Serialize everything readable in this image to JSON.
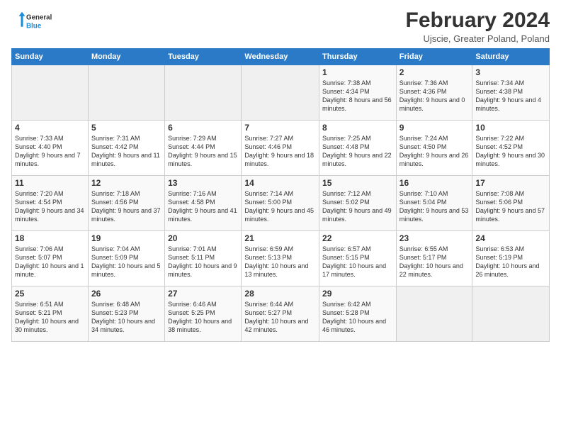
{
  "logo": {
    "general": "General",
    "blue": "Blue"
  },
  "header": {
    "title": "February 2024",
    "location": "Ujscie, Greater Poland, Poland"
  },
  "days": [
    "Sunday",
    "Monday",
    "Tuesday",
    "Wednesday",
    "Thursday",
    "Friday",
    "Saturday"
  ],
  "weeks": [
    [
      {
        "day": "",
        "detail": ""
      },
      {
        "day": "",
        "detail": ""
      },
      {
        "day": "",
        "detail": ""
      },
      {
        "day": "",
        "detail": ""
      },
      {
        "day": "1",
        "detail": "Sunrise: 7:38 AM\nSunset: 4:34 PM\nDaylight: 8 hours\nand 56 minutes."
      },
      {
        "day": "2",
        "detail": "Sunrise: 7:36 AM\nSunset: 4:36 PM\nDaylight: 9 hours\nand 0 minutes."
      },
      {
        "day": "3",
        "detail": "Sunrise: 7:34 AM\nSunset: 4:38 PM\nDaylight: 9 hours\nand 4 minutes."
      }
    ],
    [
      {
        "day": "4",
        "detail": "Sunrise: 7:33 AM\nSunset: 4:40 PM\nDaylight: 9 hours\nand 7 minutes."
      },
      {
        "day": "5",
        "detail": "Sunrise: 7:31 AM\nSunset: 4:42 PM\nDaylight: 9 hours\nand 11 minutes."
      },
      {
        "day": "6",
        "detail": "Sunrise: 7:29 AM\nSunset: 4:44 PM\nDaylight: 9 hours\nand 15 minutes."
      },
      {
        "day": "7",
        "detail": "Sunrise: 7:27 AM\nSunset: 4:46 PM\nDaylight: 9 hours\nand 18 minutes."
      },
      {
        "day": "8",
        "detail": "Sunrise: 7:25 AM\nSunset: 4:48 PM\nDaylight: 9 hours\nand 22 minutes."
      },
      {
        "day": "9",
        "detail": "Sunrise: 7:24 AM\nSunset: 4:50 PM\nDaylight: 9 hours\nand 26 minutes."
      },
      {
        "day": "10",
        "detail": "Sunrise: 7:22 AM\nSunset: 4:52 PM\nDaylight: 9 hours\nand 30 minutes."
      }
    ],
    [
      {
        "day": "11",
        "detail": "Sunrise: 7:20 AM\nSunset: 4:54 PM\nDaylight: 9 hours\nand 34 minutes."
      },
      {
        "day": "12",
        "detail": "Sunrise: 7:18 AM\nSunset: 4:56 PM\nDaylight: 9 hours\nand 37 minutes."
      },
      {
        "day": "13",
        "detail": "Sunrise: 7:16 AM\nSunset: 4:58 PM\nDaylight: 9 hours\nand 41 minutes."
      },
      {
        "day": "14",
        "detail": "Sunrise: 7:14 AM\nSunset: 5:00 PM\nDaylight: 9 hours\nand 45 minutes."
      },
      {
        "day": "15",
        "detail": "Sunrise: 7:12 AM\nSunset: 5:02 PM\nDaylight: 9 hours\nand 49 minutes."
      },
      {
        "day": "16",
        "detail": "Sunrise: 7:10 AM\nSunset: 5:04 PM\nDaylight: 9 hours\nand 53 minutes."
      },
      {
        "day": "17",
        "detail": "Sunrise: 7:08 AM\nSunset: 5:06 PM\nDaylight: 9 hours\nand 57 minutes."
      }
    ],
    [
      {
        "day": "18",
        "detail": "Sunrise: 7:06 AM\nSunset: 5:07 PM\nDaylight: 10 hours\nand 1 minute."
      },
      {
        "day": "19",
        "detail": "Sunrise: 7:04 AM\nSunset: 5:09 PM\nDaylight: 10 hours\nand 5 minutes."
      },
      {
        "day": "20",
        "detail": "Sunrise: 7:01 AM\nSunset: 5:11 PM\nDaylight: 10 hours\nand 9 minutes."
      },
      {
        "day": "21",
        "detail": "Sunrise: 6:59 AM\nSunset: 5:13 PM\nDaylight: 10 hours\nand 13 minutes."
      },
      {
        "day": "22",
        "detail": "Sunrise: 6:57 AM\nSunset: 5:15 PM\nDaylight: 10 hours\nand 17 minutes."
      },
      {
        "day": "23",
        "detail": "Sunrise: 6:55 AM\nSunset: 5:17 PM\nDaylight: 10 hours\nand 22 minutes."
      },
      {
        "day": "24",
        "detail": "Sunrise: 6:53 AM\nSunset: 5:19 PM\nDaylight: 10 hours\nand 26 minutes."
      }
    ],
    [
      {
        "day": "25",
        "detail": "Sunrise: 6:51 AM\nSunset: 5:21 PM\nDaylight: 10 hours\nand 30 minutes."
      },
      {
        "day": "26",
        "detail": "Sunrise: 6:48 AM\nSunset: 5:23 PM\nDaylight: 10 hours\nand 34 minutes."
      },
      {
        "day": "27",
        "detail": "Sunrise: 6:46 AM\nSunset: 5:25 PM\nDaylight: 10 hours\nand 38 minutes."
      },
      {
        "day": "28",
        "detail": "Sunrise: 6:44 AM\nSunset: 5:27 PM\nDaylight: 10 hours\nand 42 minutes."
      },
      {
        "day": "29",
        "detail": "Sunrise: 6:42 AM\nSunset: 5:28 PM\nDaylight: 10 hours\nand 46 minutes."
      },
      {
        "day": "",
        "detail": ""
      },
      {
        "day": "",
        "detail": ""
      }
    ]
  ]
}
